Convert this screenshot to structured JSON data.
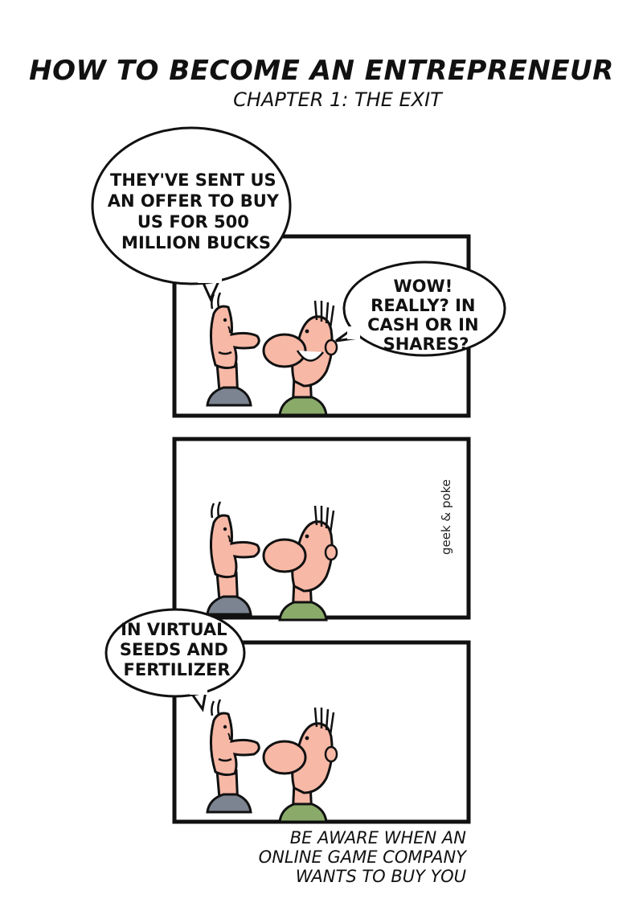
{
  "comic": {
    "title": "HOW TO BECOME AN ENTREPRENEUR",
    "subtitle": "CHAPTER 1: THE EXIT",
    "credit": "geek & poke"
  },
  "panels": [
    {
      "speech": [
        {
          "speaker": "left",
          "lines": [
            "THEY'VE SENT US",
            "AN OFFER TO BUY",
            "US FOR 500",
            "MILLION BUCKS"
          ]
        },
        {
          "speaker": "right",
          "lines": [
            "WOW!",
            "REALLY? IN",
            "CASH OR IN",
            "SHARES?"
          ]
        }
      ]
    },
    {
      "speech": []
    },
    {
      "speech": [
        {
          "speaker": "left",
          "lines": [
            "IN VIRTUAL",
            "SEEDS AND",
            "FERTILIZER"
          ]
        }
      ]
    }
  ],
  "caption": {
    "lines": [
      "BE AWARE WHEN AN",
      "ONLINE GAME COMPANY",
      "WANTS TO BUY YOU"
    ]
  },
  "colors": {
    "skin": "#f7b8a6",
    "left_shirt": "#7b8490",
    "right_shirt": "#8aaa6a",
    "ink": "#111111"
  }
}
